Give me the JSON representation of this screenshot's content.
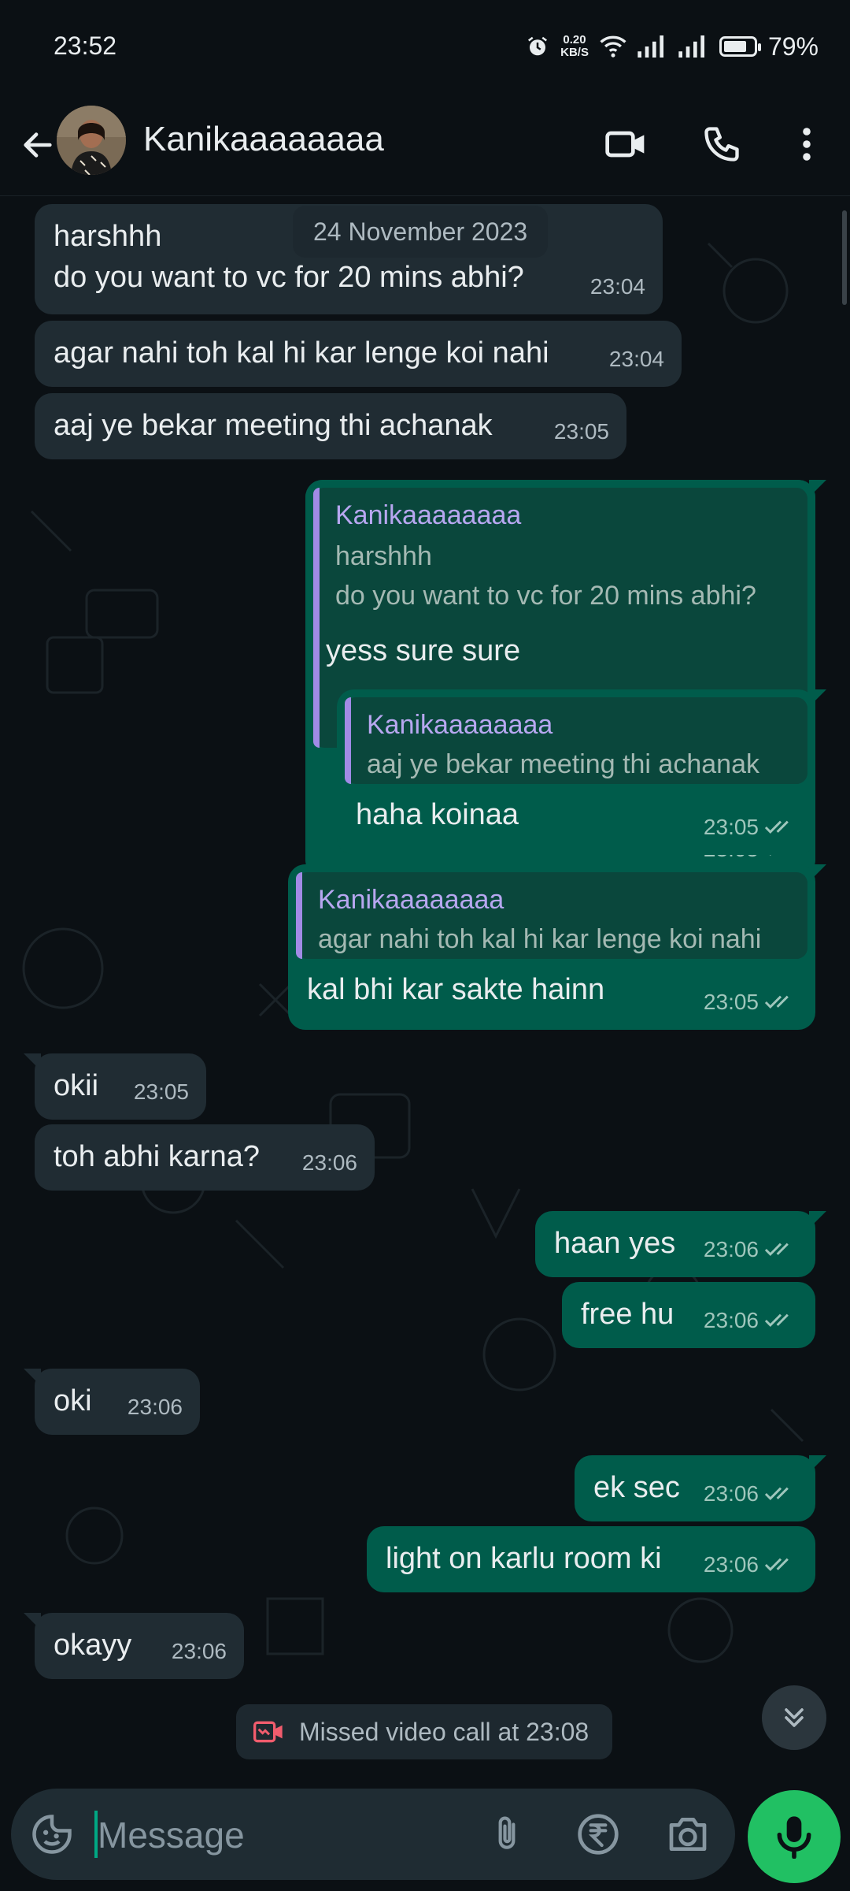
{
  "status_bar": {
    "time": "23:52",
    "net_speed_value": "0.20",
    "net_speed_unit": "KB/S",
    "battery": "79%",
    "battery_level": 0.79
  },
  "header": {
    "contact_name": "Kanikaaaaaaaa",
    "icons": [
      "back-arrow-icon",
      "video-call-icon",
      "phone-icon",
      "more-vert-icon"
    ]
  },
  "chat": {
    "date_chip": "24 November 2023",
    "messages": [
      {
        "dir": "in",
        "lines": [
          "harshhh",
          "do you want to vc for 20 mins abhi?"
        ],
        "time": "23:04"
      },
      {
        "dir": "in",
        "text": "agar nahi toh kal hi kar lenge koi nahi",
        "time": "23:04"
      },
      {
        "dir": "in",
        "text": "aaj ye bekar meeting thi achanak",
        "time": "23:05"
      },
      {
        "dir": "out",
        "quote": {
          "name": "Kanikaaaaaaaa",
          "lines": [
            "harshhh",
            "do you want to vc for 20 mins abhi?"
          ]
        },
        "text": "yess sure sure",
        "time": "23:05"
      },
      {
        "dir": "out",
        "quote": {
          "name": "Kanikaaaaaaaa",
          "lines": [
            "aaj ye bekar meeting thi achanak"
          ]
        },
        "text": "haha koinaa",
        "time": "23:05"
      },
      {
        "dir": "out",
        "quote": {
          "name": "Kanikaaaaaaaa",
          "lines": [
            "agar nahi toh kal hi kar lenge koi nahi"
          ]
        },
        "text": "kal bhi kar sakte hainn",
        "time": "23:05"
      },
      {
        "dir": "in",
        "text": "okii",
        "time": "23:05"
      },
      {
        "dir": "in",
        "text": "toh abhi karna?",
        "time": "23:06"
      },
      {
        "dir": "out",
        "text": "haan yes",
        "time": "23:06"
      },
      {
        "dir": "out",
        "text": "free hu",
        "time": "23:06"
      },
      {
        "dir": "in",
        "text": "oki",
        "time": "23:06"
      },
      {
        "dir": "out",
        "text": "ek sec",
        "time": "23:06"
      },
      {
        "dir": "out",
        "text": "light on karlu room ki",
        "time": "23:06"
      },
      {
        "dir": "in",
        "text": "okayy",
        "time": "23:06"
      }
    ],
    "missed_call": "Missed video call at 23:08"
  },
  "composer": {
    "placeholder": "Message",
    "icons": [
      "sticker-icon",
      "attach-icon",
      "rupee-payment-icon",
      "camera-icon",
      "mic-icon"
    ]
  },
  "colors": {
    "background": "#0b1014",
    "incoming_bubble": "#202c33",
    "outgoing_bubble": "#005c4b",
    "quote_accent": "#a18be6",
    "mic_button": "#21c063",
    "missed_call_icon": "#f15c6d"
  }
}
